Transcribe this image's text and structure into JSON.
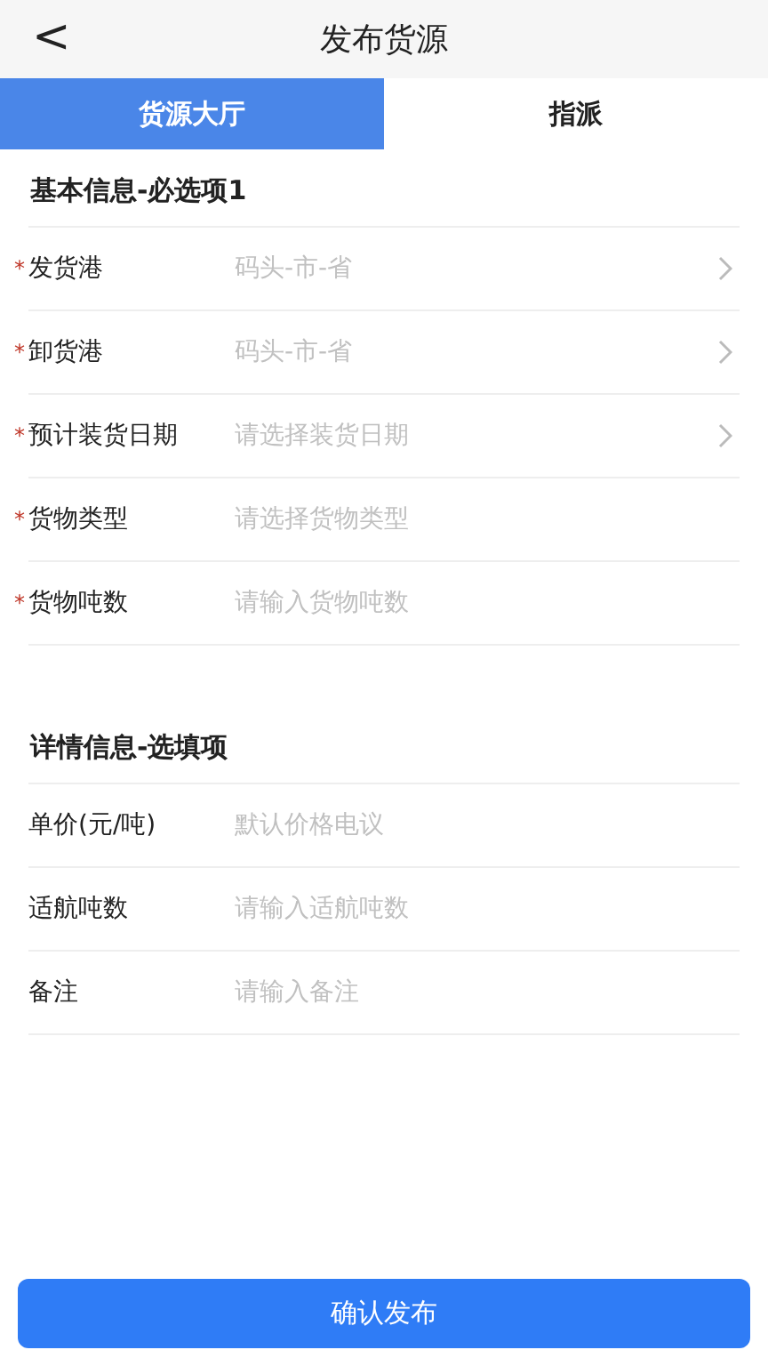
{
  "header": {
    "back": "<",
    "title": "发布货源"
  },
  "tabs": [
    {
      "label": "货源大厅",
      "selected": true
    },
    {
      "label": "指派",
      "selected": false
    }
  ],
  "sections": [
    {
      "title": "基本信息-必选项1",
      "fields": [
        {
          "mark": "*",
          "label": "发货港",
          "placeholder": "码头-市-省",
          "kind": "select"
        },
        {
          "mark": "*",
          "label": "卸货港",
          "placeholder": "码头-市-省",
          "kind": "select"
        },
        {
          "mark": "*",
          "label": "预计装货日期",
          "placeholder": "请选择装货日期",
          "kind": "select"
        },
        {
          "mark": "*",
          "label": "货物类型",
          "placeholder": "请选择货物类型",
          "kind": "input"
        },
        {
          "mark": "*",
          "label": "货物吨数",
          "placeholder": "请输入货物吨数",
          "kind": "input"
        }
      ]
    },
    {
      "title": "详情信息-选填项",
      "fields": [
        {
          "label": "单价(元/吨)",
          "placeholder": "默认价格电议",
          "kind": "input"
        },
        {
          "label": "适航吨数",
          "placeholder": "请输入适航吨数",
          "kind": "input"
        },
        {
          "label": "备注",
          "placeholder": "请输入备注",
          "kind": "input"
        }
      ]
    }
  ],
  "submit": "确认发布"
}
